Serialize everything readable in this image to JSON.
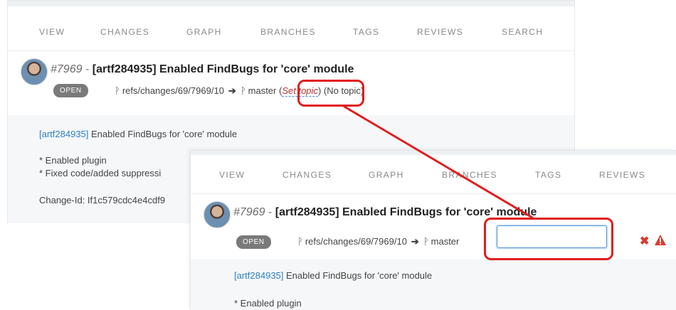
{
  "nav": {
    "items": [
      "VIEW",
      "CHANGES",
      "GRAPH",
      "BRANCHES",
      "TAGS",
      "REVIEWS",
      "SEARCH"
    ]
  },
  "review": {
    "change_number": "#7969",
    "dash": "-",
    "title": "[artf284935] Enabled FindBugs for 'core' module",
    "status": "OPEN",
    "ref": "refs/changes/69/7969/10",
    "target_branch": "master",
    "set_topic_label": "Set topic",
    "no_topic_label": "(No topic)",
    "open_paren": "(",
    "close_paren": ")",
    "commit_ticket": "[artf284935]",
    "commit_summary": "Enabled FindBugs for 'core' module",
    "bullet_1": "* Enabled plugin",
    "bullet_2": "* Fixed code/added suppressi",
    "change_id": "Change-Id: If1c579cdc4e4cdf9"
  },
  "topic_input": {
    "value": ""
  },
  "colors": {
    "accent_link": "#2f7fc4",
    "set_topic": "#c0312e",
    "callout": "#e01d1d",
    "badge": "#7a7a7a",
    "warning": "#d63a2f"
  },
  "icons": [
    "branch-icon",
    "arrow-right-icon",
    "close-icon",
    "warning-icon",
    "avatar"
  ]
}
